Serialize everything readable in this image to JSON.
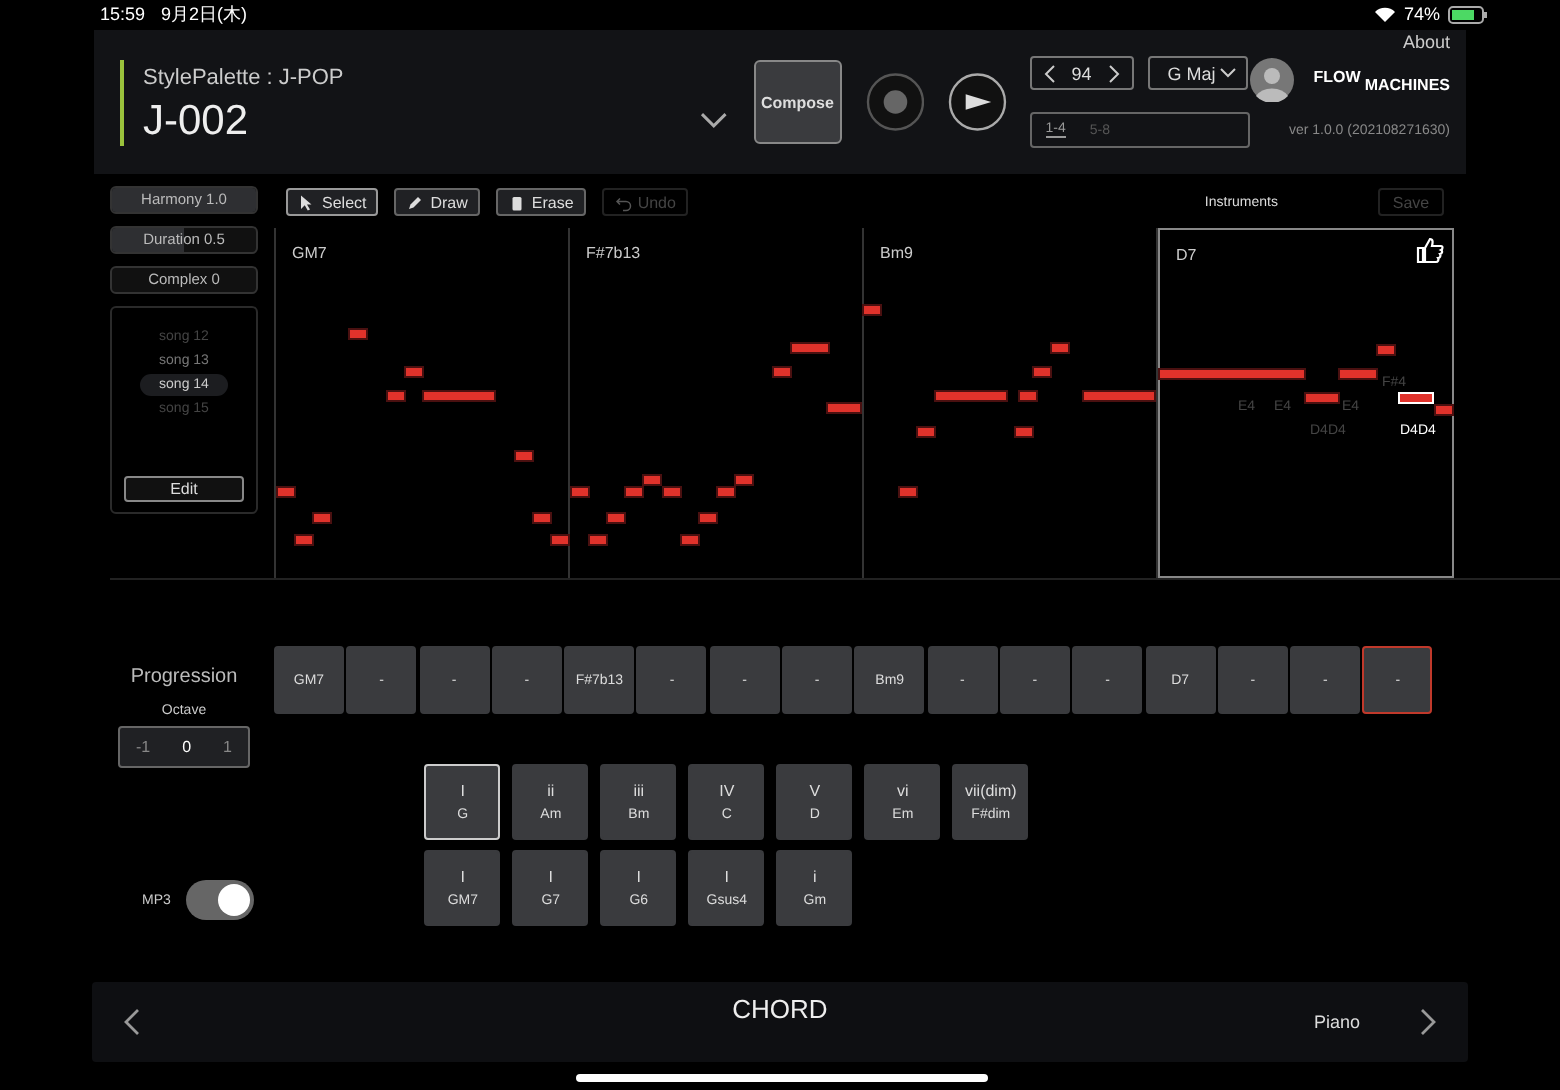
{
  "status_bar": {
    "time": "15:59",
    "date": "9月2日(木)",
    "battery": "74%"
  },
  "header": {
    "style_palette": "StylePalette : J-POP",
    "song_title": "J-002",
    "compose_button": "Compose",
    "tempo": "94",
    "key": "G Maj",
    "logo_top": "FLOW",
    "logo_bottom": "MACHINES",
    "about": "About",
    "version": "ver 1.0.0 (202108271630)",
    "bar_tabs": [
      {
        "label": "1-4",
        "selected": true
      },
      {
        "label": "5-8",
        "selected": false
      }
    ]
  },
  "parameters": [
    {
      "label": "Harmony 1.0",
      "level": 1.0
    },
    {
      "label": "Duration 0.5",
      "level": 0.5
    },
    {
      "label": "Complex 0",
      "level": 0
    }
  ],
  "songs": [
    {
      "label": "song 12",
      "selected": false,
      "faded": true
    },
    {
      "label": "song 13",
      "selected": false,
      "faded": false
    },
    {
      "label": "song 14",
      "selected": true,
      "faded": false
    },
    {
      "label": "song 15",
      "selected": false,
      "faded": true
    }
  ],
  "edit_button": "Edit",
  "toolbar": [
    {
      "label": "Select",
      "kind": "select",
      "selected": true,
      "disabled": false
    },
    {
      "label": "Draw",
      "kind": "draw",
      "selected": false,
      "disabled": false
    },
    {
      "label": "Erase",
      "kind": "erase",
      "selected": false,
      "disabled": false
    }
  ],
  "undo_button": {
    "label": "Undo",
    "disabled": true
  },
  "instruments_label": "Instruments",
  "save_button": {
    "label": "Save",
    "disabled": true
  },
  "bars": [
    {
      "chord": "GM7",
      "selected": false,
      "liked": false
    },
    {
      "chord": "F#7b13",
      "selected": false,
      "liked": false
    },
    {
      "chord": "Bm9",
      "selected": false,
      "liked": false
    },
    {
      "chord": "D7",
      "selected": true,
      "liked": true,
      "note_labels": [
        {
          "text": "E4",
          "selected": false
        },
        {
          "text": "E4",
          "selected": false
        },
        {
          "text": "E4",
          "selected": false
        },
        {
          "text": "F#4",
          "selected": false
        },
        {
          "text": "D4D4",
          "selected": false
        },
        {
          "text": "D4D4",
          "selected": true
        }
      ]
    }
  ],
  "progression": {
    "title": "Progression",
    "cells": [
      {
        "label": "GM7",
        "selected": false
      },
      {
        "label": "-",
        "selected": false
      },
      {
        "label": "-",
        "selected": false
      },
      {
        "label": "-",
        "selected": false
      },
      {
        "label": "F#7b13",
        "selected": false
      },
      {
        "label": "-",
        "selected": false
      },
      {
        "label": "-",
        "selected": false
      },
      {
        "label": "-",
        "selected": false
      },
      {
        "label": "Bm9",
        "selected": false
      },
      {
        "label": "-",
        "selected": false
      },
      {
        "label": "-",
        "selected": false
      },
      {
        "label": "-",
        "selected": false
      },
      {
        "label": "D7",
        "selected": false
      },
      {
        "label": "-",
        "selected": false
      },
      {
        "label": "-",
        "selected": false
      },
      {
        "label": "-",
        "selected": true
      }
    ]
  },
  "octave": {
    "title": "Octave",
    "options": [
      {
        "label": "-1",
        "selected": false
      },
      {
        "label": "0",
        "selected": true
      },
      {
        "label": "1",
        "selected": false
      }
    ]
  },
  "chord_palette": [
    [
      {
        "degree": "I",
        "chord": "G",
        "selected": true
      },
      {
        "degree": "ii",
        "chord": "Am",
        "selected": false
      },
      {
        "degree": "iii",
        "chord": "Bm",
        "selected": false
      },
      {
        "degree": "IV",
        "chord": "C",
        "selected": false
      },
      {
        "degree": "V",
        "chord": "D",
        "selected": false
      },
      {
        "degree": "vi",
        "chord": "Em",
        "selected": false
      },
      {
        "degree": "vii(dim)",
        "chord": "F#dim",
        "selected": false
      }
    ],
    [
      {
        "degree": "I",
        "chord": "GM7",
        "selected": false
      },
      {
        "degree": "I",
        "chord": "G7",
        "selected": false
      },
      {
        "degree": "I",
        "chord": "G6",
        "selected": false
      },
      {
        "degree": "I",
        "chord": "Gsus4",
        "selected": false
      },
      {
        "degree": "i",
        "chord": "Gm",
        "selected": false
      }
    ]
  ],
  "mp3": {
    "label": "MP3",
    "on": true
  },
  "bottom_bar": {
    "title": "CHORD",
    "instrument": "Piano"
  }
}
